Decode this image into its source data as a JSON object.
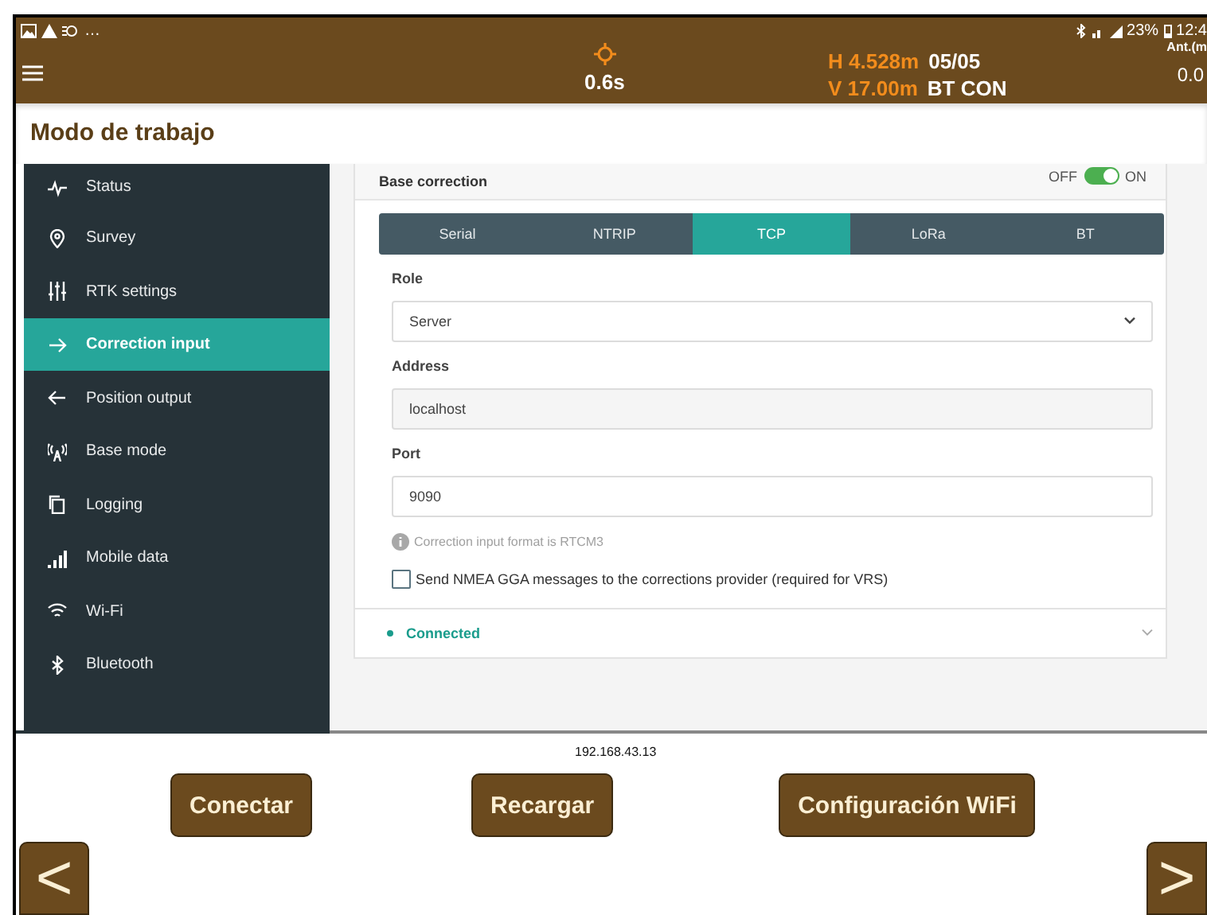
{
  "status_bar": {
    "notification_more": "…",
    "battery": "23%",
    "time": "12:4"
  },
  "header": {
    "timer": "0.6s",
    "height": "H 4.528m",
    "satellites": "05/05",
    "vertical": "V 17.00m",
    "connection": "BT CON",
    "antenna_label": "Ant.(m",
    "antenna_value": "0.0"
  },
  "title": "Modo de trabajo",
  "sidebar": {
    "items": [
      {
        "label": "Status",
        "kind": "pulse",
        "selected": false
      },
      {
        "label": "Survey",
        "kind": "pin",
        "selected": false
      },
      {
        "label": "RTK settings",
        "kind": "sliders",
        "selected": false
      },
      {
        "label": "Correction input",
        "kind": "forward",
        "selected": true
      },
      {
        "label": "Position output",
        "kind": "back",
        "selected": false
      },
      {
        "label": "Base mode",
        "kind": "tower",
        "selected": false
      },
      {
        "label": "Logging",
        "kind": "copy",
        "selected": false
      },
      {
        "label": "Mobile data",
        "kind": "bars",
        "selected": false
      },
      {
        "label": "Wi-Fi",
        "kind": "wifi",
        "selected": false
      },
      {
        "label": "Bluetooth",
        "kind": "bluetooth",
        "selected": false
      }
    ]
  },
  "card": {
    "title": "Base correction",
    "toggle": {
      "off_label": "OFF",
      "on_label": "ON",
      "on": true
    },
    "tabs": [
      {
        "label": "Serial",
        "selected": false
      },
      {
        "label": "NTRIP",
        "selected": false
      },
      {
        "label": "TCP",
        "selected": true
      },
      {
        "label": "LoRa",
        "selected": false
      },
      {
        "label": "BT",
        "selected": false
      }
    ],
    "fields": [
      {
        "label": "Role",
        "kind": "select",
        "value": "Server"
      },
      {
        "label": "Address",
        "kind": "readonly",
        "value": "localhost"
      },
      {
        "label": "Port",
        "kind": "input",
        "value": "9090"
      }
    ],
    "hint": "Correction input format is RTCM3",
    "checkbox": {
      "label": "Send NMEA GGA messages to the corrections provider (required for VRS)",
      "checked": false
    },
    "status": {
      "label": "Connected",
      "color": "#1a9c8c"
    }
  },
  "ip": "192.168.43.13",
  "buttons": [
    "Conectar",
    "Recargar",
    "Configuración WiFi"
  ],
  "nav": {
    "back": "<",
    "forward": ">"
  }
}
